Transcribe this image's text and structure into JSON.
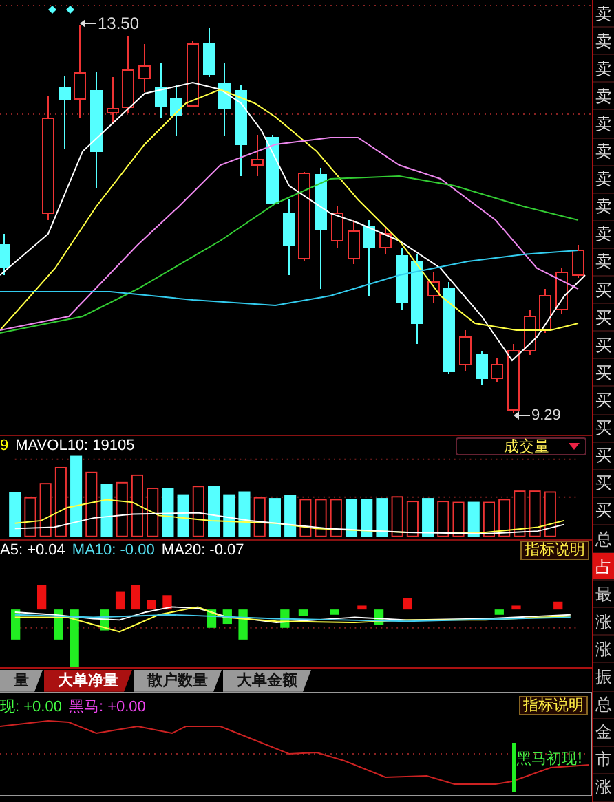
{
  "price_chart": {
    "high_label": "13.50",
    "low_label": "9.29"
  },
  "volume_panel": {
    "legend": [
      {
        "text": "9",
        "color": "#ffff00"
      },
      {
        "text": "MAVOL10: 19105",
        "color": "#ffffff"
      }
    ],
    "indicator_dropdown": "成交量"
  },
  "indicator_panel": {
    "legend": [
      {
        "text": "A5: +0.04",
        "color": "#ffffff"
      },
      {
        "text": "MA10: -0.00",
        "color": "#55ddee"
      },
      {
        "text": "MA20: -0.07",
        "color": "#ffffff"
      }
    ],
    "help_button": "指标说明"
  },
  "tabs": [
    {
      "label": "量",
      "selected": false
    },
    {
      "label": "大单净量",
      "selected": true
    },
    {
      "label": "散户数量",
      "selected": false
    },
    {
      "label": "大单金额",
      "selected": false
    }
  ],
  "bottom_panel": {
    "legend": [
      {
        "text": "现: +0.00",
        "color": "#44ff44"
      },
      {
        "text": "黑马: +0.00",
        "color": "#ee44ee"
      }
    ],
    "help_button": "指标说明",
    "signal_label": "黑马初现!"
  },
  "side_tabs": [
    {
      "label": "卖",
      "kind": "sell",
      "selected": false
    },
    {
      "label": "卖",
      "kind": "sell",
      "selected": false
    },
    {
      "label": "卖",
      "kind": "sell",
      "selected": false
    },
    {
      "label": "卖",
      "kind": "sell",
      "selected": false
    },
    {
      "label": "卖",
      "kind": "sell",
      "selected": false
    },
    {
      "label": "卖",
      "kind": "sell",
      "selected": false
    },
    {
      "label": "卖",
      "kind": "sell",
      "selected": false
    },
    {
      "label": "卖",
      "kind": "sell",
      "selected": false
    },
    {
      "label": "卖",
      "kind": "sell",
      "selected": false
    },
    {
      "label": "卖",
      "kind": "sell",
      "selected": false
    },
    {
      "label": "买",
      "kind": "buy",
      "selected": false
    },
    {
      "label": "买",
      "kind": "buy",
      "selected": false
    },
    {
      "label": "买",
      "kind": "buy",
      "selected": false
    },
    {
      "label": "买",
      "kind": "buy",
      "selected": false
    },
    {
      "label": "买",
      "kind": "buy",
      "selected": false
    },
    {
      "label": "买",
      "kind": "buy",
      "selected": false
    },
    {
      "label": "买",
      "kind": "buy",
      "selected": false
    },
    {
      "label": "买",
      "kind": "buy",
      "selected": false
    },
    {
      "label": "买",
      "kind": "buy",
      "selected": false
    },
    {
      "label": "总",
      "kind": "stat",
      "selected": false
    },
    {
      "label": "占",
      "kind": "stat",
      "selected": true
    },
    {
      "label": "最",
      "kind": "stat",
      "selected": false
    },
    {
      "label": "涨",
      "kind": "stat",
      "selected": false
    },
    {
      "label": "涨",
      "kind": "stat",
      "selected": false
    },
    {
      "label": "振",
      "kind": "stat",
      "selected": false
    },
    {
      "label": "总",
      "kind": "stat",
      "selected": false
    },
    {
      "label": "金",
      "kind": "stat",
      "selected": false
    },
    {
      "label": "市",
      "kind": "stat",
      "selected": false
    },
    {
      "label": "涨",
      "kind": "stat",
      "selected": false
    }
  ]
}
